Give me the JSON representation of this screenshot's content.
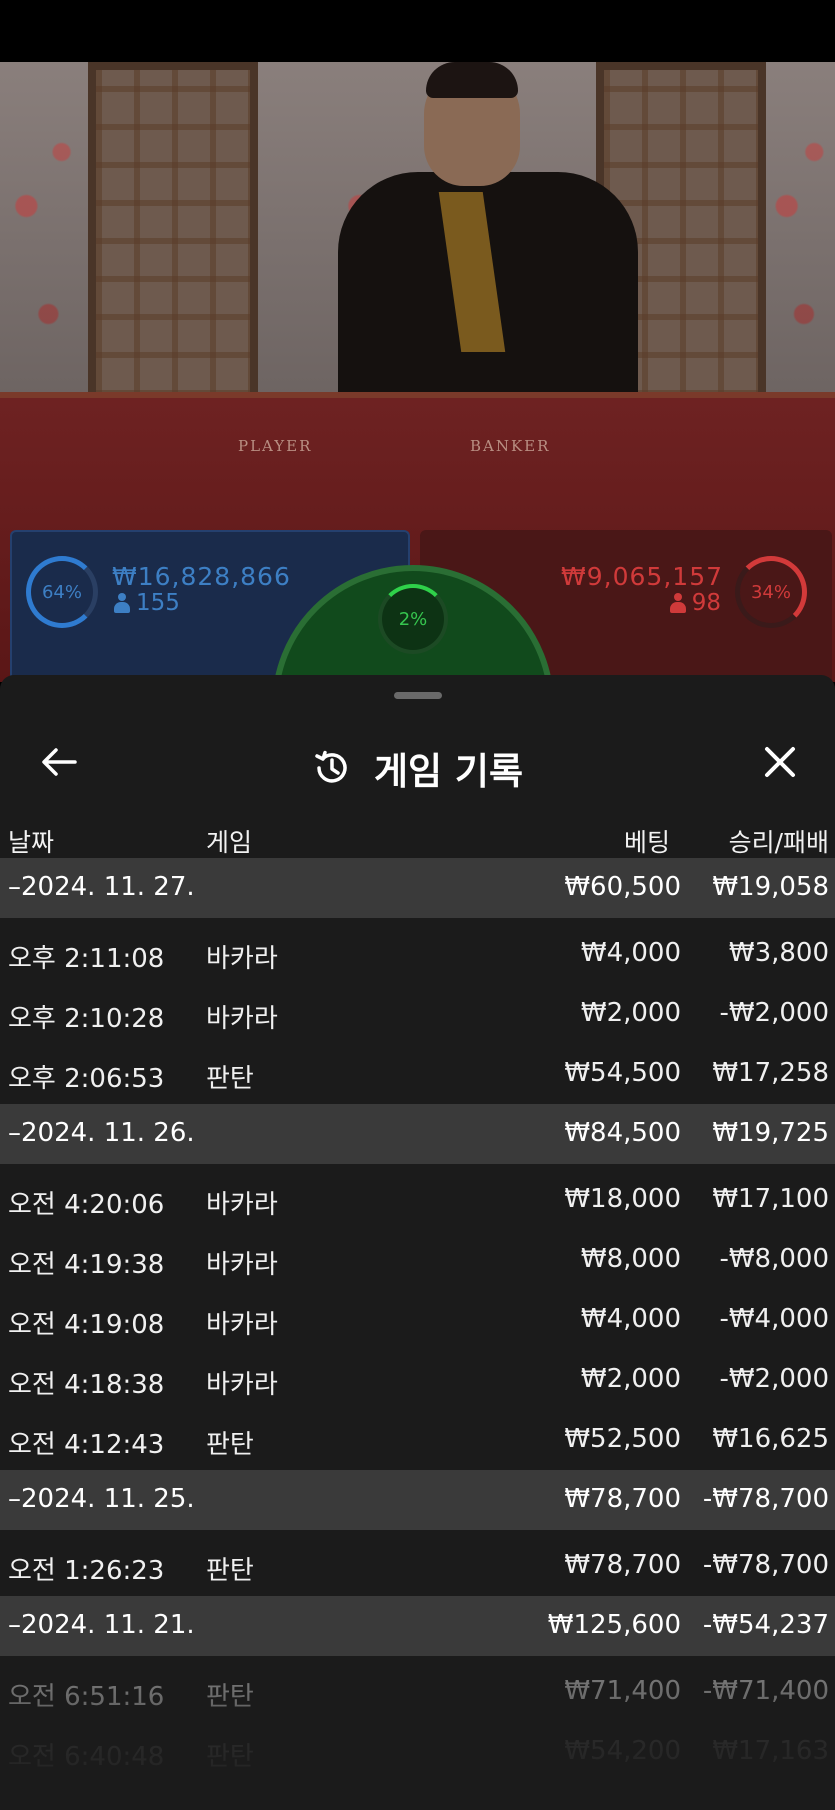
{
  "video": {
    "player_label": "PLAYER",
    "banker_label": "BANKER"
  },
  "bets": {
    "player": {
      "percent": "64%",
      "amount": "₩16,828,866",
      "count": "155",
      "color": "#3d7fc4"
    },
    "tie": {
      "percent": "2%",
      "color": "#36c64f"
    },
    "banker": {
      "percent": "34%",
      "amount": "₩9,065,157",
      "count": "98",
      "color": "#d03a3a"
    }
  },
  "sheet": {
    "title": "게임 기록",
    "icons": {
      "back": "arrow-left-icon",
      "history": "history-icon",
      "close": "close-icon"
    },
    "columns": {
      "date": "날짜",
      "game": "게임",
      "bet": "베팅",
      "win_loss": "승리/패배"
    },
    "groups": [
      {
        "date": "–2024. 11. 27.",
        "bet": "₩60,500",
        "win": "₩19,058",
        "rows": [
          {
            "time": "오후 2:11:08",
            "game": "바카라",
            "bet": "₩4,000",
            "win": "₩3,800"
          },
          {
            "time": "오후 2:10:28",
            "game": "바카라",
            "bet": "₩2,000",
            "win": "-₩2,000"
          },
          {
            "time": "오후 2:06:53",
            "game": "판탄",
            "bet": "₩54,500",
            "win": "₩17,258"
          }
        ]
      },
      {
        "date": "–2024. 11. 26.",
        "bet": "₩84,500",
        "win": "₩19,725",
        "rows": [
          {
            "time": "오전 4:20:06",
            "game": "바카라",
            "bet": "₩18,000",
            "win": "₩17,100"
          },
          {
            "time": "오전 4:19:38",
            "game": "바카라",
            "bet": "₩8,000",
            "win": "-₩8,000"
          },
          {
            "time": "오전 4:19:08",
            "game": "바카라",
            "bet": "₩4,000",
            "win": "-₩4,000"
          },
          {
            "time": "오전 4:18:38",
            "game": "바카라",
            "bet": "₩2,000",
            "win": "-₩2,000"
          },
          {
            "time": "오전 4:12:43",
            "game": "판탄",
            "bet": "₩52,500",
            "win": "₩16,625"
          }
        ]
      },
      {
        "date": "–2024. 11. 25.",
        "bet": "₩78,700",
        "win": "-₩78,700",
        "rows": [
          {
            "time": "오전 1:26:23",
            "game": "판탄",
            "bet": "₩78,700",
            "win": "-₩78,700"
          }
        ]
      },
      {
        "date": "–2024. 11. 21.",
        "bet": "₩125,600",
        "win": "-₩54,237",
        "rows": [
          {
            "time": "오전 6:51:16",
            "game": "판탄",
            "bet": "₩71,400",
            "win": "-₩71,400"
          },
          {
            "time": "오전 6:40:48",
            "game": "판탄",
            "bet": "₩54,200",
            "win": "₩17,163"
          }
        ]
      }
    ]
  }
}
